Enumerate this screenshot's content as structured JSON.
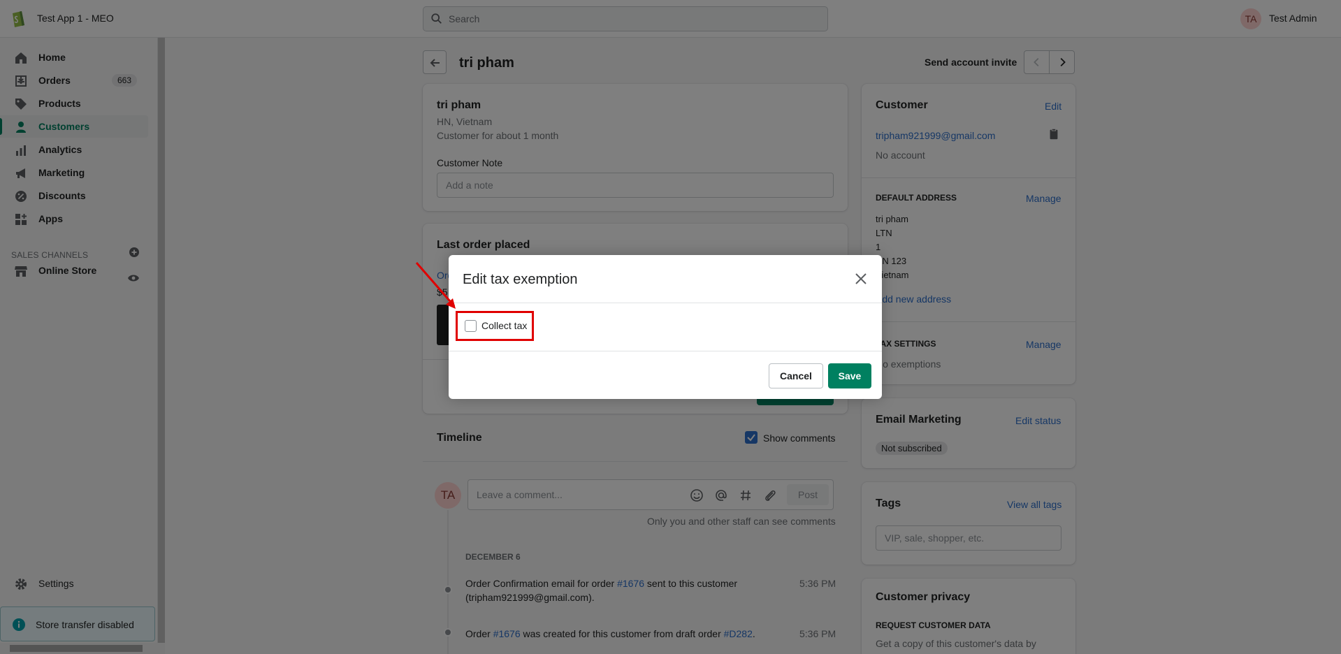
{
  "topbar": {
    "store_name": "Test App 1 - MEO",
    "search_placeholder": "Search",
    "user_initials": "TA",
    "user_name": "Test Admin"
  },
  "sidebar": {
    "items": [
      {
        "label": "Home",
        "icon": "home-icon"
      },
      {
        "label": "Orders",
        "icon": "orders-icon",
        "badge": "663"
      },
      {
        "label": "Products",
        "icon": "tag-icon"
      },
      {
        "label": "Customers",
        "icon": "person-icon"
      },
      {
        "label": "Analytics",
        "icon": "bar-chart-icon"
      },
      {
        "label": "Marketing",
        "icon": "megaphone-icon"
      },
      {
        "label": "Discounts",
        "icon": "discount-icon"
      },
      {
        "label": "Apps",
        "icon": "apps-icon"
      }
    ],
    "sales_channels_title": "SALES CHANNELS",
    "online_store": "Online Store",
    "settings": "Settings",
    "store_transfer": "Store transfer disabled"
  },
  "page": {
    "title": "tri pham",
    "send_invite": "Send account invite"
  },
  "customer_card": {
    "name": "tri pham",
    "location": "HN, Vietnam",
    "since": "Customer for about 1 month",
    "note_label": "Customer Note",
    "note_placeholder": "Add a note"
  },
  "last_order": {
    "title": "Last order placed",
    "order_fragment": "Ord",
    "price_fragment": "$5"
  },
  "timeline": {
    "title": "Timeline",
    "show_comments": "Show comments",
    "comment_placeholder": "Leave a comment...",
    "post": "Post",
    "staff_note": "Only you and other staff can see comments",
    "date": "DECEMBER 6",
    "events": [
      {
        "text_a": "Order Confirmation email for order ",
        "link": "#1676",
        "text_b": " sent to this customer",
        "text_c": "(tripham921999@gmail.com).",
        "time": "5:36 PM"
      },
      {
        "text_a": "Order ",
        "link": "#1676",
        "text_b": " was created for this customer from draft order ",
        "link2": "#D282",
        "text_c": ".",
        "time": "5:36 PM"
      }
    ]
  },
  "right": {
    "customer_title": "Customer",
    "edit": "Edit",
    "email": "tripham921999@gmail.com",
    "no_account": "No account",
    "default_address_title": "DEFAULT ADDRESS",
    "manage": "Manage",
    "address_lines": [
      "tri pham",
      "LTN",
      "1",
      "HN 123",
      "Vietnam"
    ],
    "add_address": "Add new address",
    "tax_title": "TAX SETTINGS",
    "tax_value": "No exemptions",
    "email_marketing_title": "Email Marketing",
    "edit_status": "Edit status",
    "not_subscribed": "Not subscribed",
    "tags_title": "Tags",
    "view_all_tags": "View all tags",
    "tags_placeholder": "VIP, sale, shopper, etc.",
    "privacy_title": "Customer privacy",
    "request_data_title": "REQUEST CUSTOMER DATA",
    "request_data_text": "Get a copy of this customer's data by"
  },
  "modal": {
    "title": "Edit tax exemption",
    "checkbox_label": "Collect tax",
    "checked": false,
    "cancel": "Cancel",
    "save": "Save"
  },
  "colors": {
    "accent": "#008060",
    "link": "#2c6ecb",
    "highlight": "#e00000"
  }
}
